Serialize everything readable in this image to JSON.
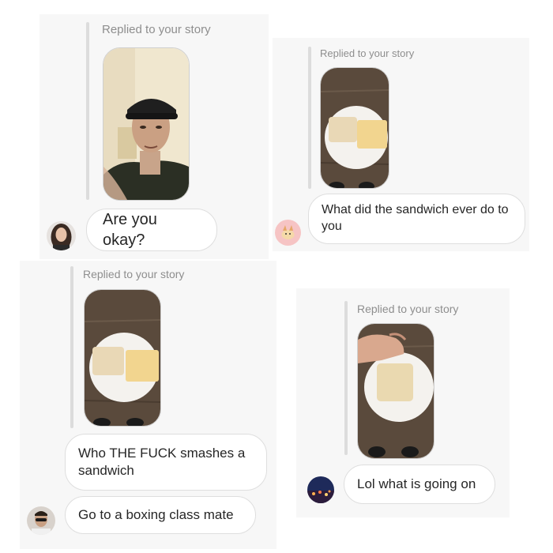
{
  "panels": [
    {
      "reply_label": "Replied to your story",
      "messages": [
        "Are you okay?"
      ]
    },
    {
      "reply_label": "Replied to your story",
      "messages": [
        "What did the sandwich ever do to you"
      ]
    },
    {
      "reply_label": "Replied to your story",
      "messages": [
        "Who THE FUCK smashes a sandwich",
        "Go to a boxing class mate"
      ]
    },
    {
      "reply_label": "Replied to your story",
      "messages": [
        "Lol what is going on"
      ]
    }
  ],
  "colors": {
    "reply_text": "#8e8e8e",
    "bubble_border": "#dedede",
    "panel_bg": "#f7f7f7"
  },
  "icons": [
    "avatar-woman",
    "avatar-corgi",
    "avatar-man-sunglasses",
    "avatar-city-night"
  ]
}
